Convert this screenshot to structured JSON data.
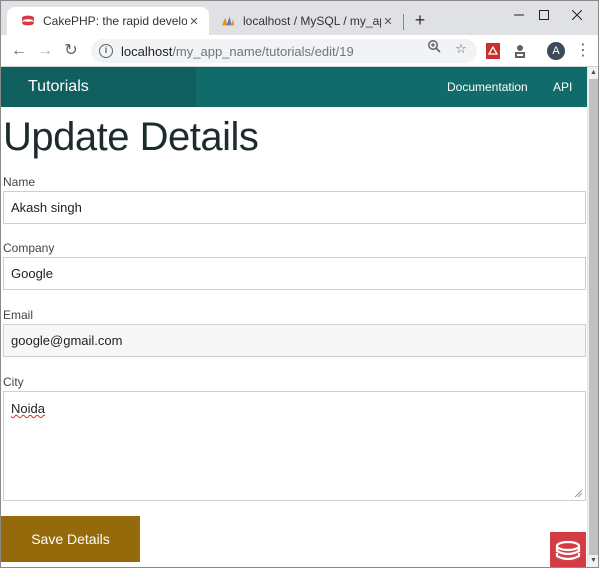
{
  "browser": {
    "tabs": [
      {
        "title": "CakePHP: the rapid development",
        "active": true,
        "favicon": "cakephp-icon"
      },
      {
        "title": "localhost / MySQL / my_app / tut",
        "active": false,
        "favicon": "phpmyadmin-icon"
      }
    ],
    "url": {
      "host": "localhost",
      "path": "/my_app_name/tutorials/edit/19"
    },
    "avatar_letter": "A"
  },
  "navbar": {
    "brand": "Tutorials",
    "links": [
      "Documentation",
      "API"
    ]
  },
  "page": {
    "title": "Update Details",
    "fields": [
      {
        "label": "Name",
        "value": "Akash singh"
      },
      {
        "label": "Company",
        "value": "Google"
      },
      {
        "label": "Email",
        "value": "google@gmail.com"
      },
      {
        "label": "City",
        "value": "Noida"
      }
    ],
    "submit_label": "Save Details"
  },
  "colors": {
    "navbar": "#116b6a",
    "brand_bg": "#0e5f5e",
    "button": "#956a0b",
    "badge": "#d33c43"
  }
}
